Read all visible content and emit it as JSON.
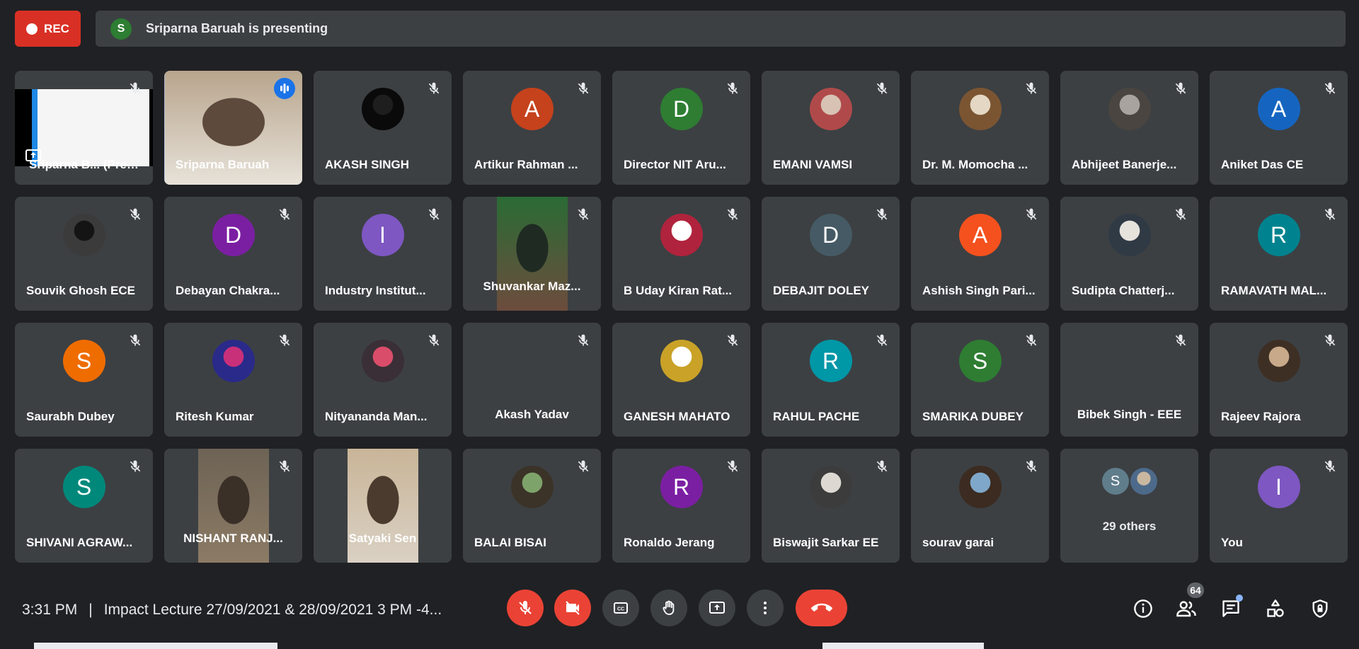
{
  "recording": {
    "label": "REC"
  },
  "presenting": {
    "initial": "S",
    "text": "Sriparna Baruah is presenting"
  },
  "colors": {
    "red": "#ea4335",
    "blue": "#1a73e8",
    "tile": "#3c4043",
    "background": "#202124"
  },
  "participants": [
    {
      "name": "Sriparna B... (Presentati...",
      "type": "presentation",
      "muted": true
    },
    {
      "name": "Sriparna Baruah",
      "type": "video",
      "muted": false,
      "speaking": true,
      "video_colors": [
        "#b8a58d",
        "#5d4a3d",
        "#e7e2d9"
      ]
    },
    {
      "name": "AKASH SINGH",
      "type": "photo",
      "photo_colors": [
        "#1e1e1e",
        "#0a0a0a"
      ],
      "muted": true
    },
    {
      "name": "Artikur Rahman ...",
      "type": "initial",
      "initial": "A",
      "color": "#c5421c",
      "muted": true
    },
    {
      "name": "Director NIT Aru...",
      "type": "initial",
      "initial": "D",
      "color": "#2e7d32",
      "muted": true
    },
    {
      "name": "EMANI VAMSI",
      "type": "photo",
      "photo_colors": [
        "#d7c2b3",
        "#b04a4a"
      ],
      "muted": true
    },
    {
      "name": "Dr. M. Momocha ...",
      "type": "photo",
      "photo_colors": [
        "#e4d7c3",
        "#7b5532"
      ],
      "muted": true
    },
    {
      "name": "Abhijeet Banerje...",
      "type": "photo",
      "photo_colors": [
        "#a8a39f",
        "#4a4540"
      ],
      "muted": true
    },
    {
      "name": "Aniket Das CE",
      "type": "initial",
      "initial": "A",
      "color": "#1565c0",
      "muted": true
    },
    {
      "name": "Souvik Ghosh ECE",
      "type": "photo",
      "photo_colors": [
        "#141414",
        "#3b3b3b"
      ],
      "muted": true
    },
    {
      "name": "Debayan Chakra...",
      "type": "initial",
      "initial": "D",
      "color": "#7b1fa2",
      "muted": true
    },
    {
      "name": "Industry Institut...",
      "type": "initial",
      "initial": "I",
      "color": "#7e57c2",
      "muted": true
    },
    {
      "name": "Shuvankar Maz...",
      "type": "video",
      "muted": true,
      "center_name": true,
      "video_colors": [
        "#2a6b35",
        "#1f2b22",
        "#6d4c3d"
      ]
    },
    {
      "name": "B Uday Kiran Rat...",
      "type": "photo",
      "photo_colors": [
        "#ffffff",
        "#b0233c"
      ],
      "muted": true
    },
    {
      "name": "DEBAJIT DOLEY",
      "type": "initial",
      "initial": "D",
      "color": "#455a64",
      "muted": true
    },
    {
      "name": "Ashish Singh Pari...",
      "type": "initial",
      "initial": "A",
      "color": "#f4511e",
      "muted": true
    },
    {
      "name": "Sudipta Chatterj...",
      "type": "photo",
      "photo_colors": [
        "#e6e2dc",
        "#2f3a45"
      ],
      "muted": true
    },
    {
      "name": "RAMAVATH MAL...",
      "type": "initial",
      "initial": "R",
      "color": "#00838f",
      "muted": true
    },
    {
      "name": "Saurabh Dubey",
      "type": "initial",
      "initial": "S",
      "color": "#ef6c00",
      "muted": true
    },
    {
      "name": "Ritesh Kumar",
      "type": "photo",
      "photo_colors": [
        "#c9307a",
        "#2a2a8a"
      ],
      "muted": true
    },
    {
      "name": "Nityananda Man...",
      "type": "photo",
      "photo_colors": [
        "#d94d6a",
        "#3a2f36"
      ],
      "muted": true
    },
    {
      "name": "Akash Yadav",
      "type": "none",
      "muted": true,
      "center_name": true
    },
    {
      "name": "GANESH MAHATO",
      "type": "photo",
      "photo_colors": [
        "#ffffff",
        "#c9a227"
      ],
      "muted": true
    },
    {
      "name": "RAHUL PACHE",
      "type": "initial",
      "initial": "R",
      "color": "#0097a7",
      "muted": true
    },
    {
      "name": "SMARIKA DUBEY",
      "type": "initial",
      "initial": "S",
      "color": "#2e7d32",
      "muted": true
    },
    {
      "name": "Bibek Singh - EEE",
      "type": "none",
      "muted": true,
      "center_name": true
    },
    {
      "name": "Rajeev Rajora",
      "type": "photo",
      "photo_colors": [
        "#c8a989",
        "#3e2f25"
      ],
      "muted": true
    },
    {
      "name": "SHIVANI AGRAW...",
      "type": "initial",
      "initial": "S",
      "color": "#00897b",
      "muted": true
    },
    {
      "name": "NISHANT RANJ...",
      "type": "video",
      "muted": true,
      "center_name": true,
      "video_colors": [
        "#6d6355",
        "#3a3028",
        "#8c7b65"
      ]
    },
    {
      "name": "Satyaki Sen",
      "type": "video",
      "muted": false,
      "center_name": true,
      "video_colors": [
        "#c9b598",
        "#4a3b2e",
        "#dad1c4"
      ]
    },
    {
      "name": "BALAI BISAI",
      "type": "photo",
      "photo_colors": [
        "#7ea36a",
        "#3b3328"
      ],
      "muted": true
    },
    {
      "name": "Ronaldo Jerang",
      "type": "initial",
      "initial": "R",
      "color": "#7b1fa2",
      "muted": true
    },
    {
      "name": "Biswajit Sarkar EE",
      "type": "photo",
      "photo_colors": [
        "#ddd9d2",
        "#3c3c3c"
      ],
      "muted": true
    },
    {
      "name": "sourav garai",
      "type": "photo",
      "photo_colors": [
        "#7fa7c9",
        "#3b2b20"
      ],
      "muted": true
    },
    {
      "name": "29 others",
      "type": "others",
      "muted": false,
      "others_initial": "S"
    },
    {
      "name": "You",
      "type": "initial",
      "initial": "I",
      "color": "#7e57c2",
      "muted": true
    }
  ],
  "footer": {
    "time": "3:31 PM",
    "separator": "|",
    "meeting_title": "Impact Lecture 27/09/2021 & 28/09/2021 3 PM -4...",
    "participant_count": "64"
  },
  "icons": {
    "mic": "mic-off-icon",
    "camera": "videocam-off-icon",
    "captions": "closed-caption-icon",
    "hand": "raise-hand-icon",
    "present": "present-screen-icon",
    "more": "more-vert-icon",
    "end": "call-end-icon",
    "info": "info-icon",
    "people": "people-icon",
    "chat": "chat-icon",
    "activities": "activities-icon",
    "host": "host-controls-icon"
  }
}
